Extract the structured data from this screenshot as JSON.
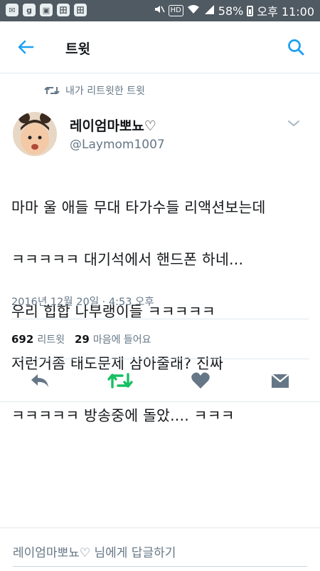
{
  "status_bar": {
    "icons": [
      "chat-icon",
      "g-icon",
      "image-icon",
      "app-icon",
      "app-icon"
    ],
    "left_glyphs": [
      "✉",
      "g",
      "▣",
      "田",
      "田"
    ],
    "hd": "HD",
    "battery": "58%",
    "time": "오후 11:00"
  },
  "header": {
    "title": "트윗",
    "accent_color": "#1da1f2"
  },
  "tweet": {
    "retweet_context": "내가 리트윗한 트윗",
    "author_name": "레이엄마뽀뇨♡",
    "author_handle": "@Laymom1007",
    "lines": [
      "마마 울 애들 무대 타가수들 리액션보는데",
      "ㅋㅋㅋㅋㅋ 대기석에서 핸드폰 하네...",
      "우리 힙합 나부랭이들 ㅋㅋㅋㅋㅋ",
      "저런거좀 태도문제 삼아줄래? 진짜",
      "ㅋㅋㅋㅋㅋ 방송중에 돌았.... ㅋㅋㅋ"
    ],
    "timestamp": "2016년 12월 20일 · 4:53 오후"
  },
  "stats": {
    "retweets": "692",
    "retweets_label": "리트윗",
    "likes": "29",
    "likes_label": "마음에 들어요"
  },
  "actions": {
    "reply_icon": "reply-icon",
    "retweet_icon": "retweet-icon",
    "like_icon": "heart-icon",
    "dm_icon": "envelope-icon",
    "retweet_color": "#17bf63",
    "icon_color": "#657786"
  },
  "reply_bar": {
    "placeholder": "레이엄마뽀뇨♡ 님에게 답글하기"
  }
}
